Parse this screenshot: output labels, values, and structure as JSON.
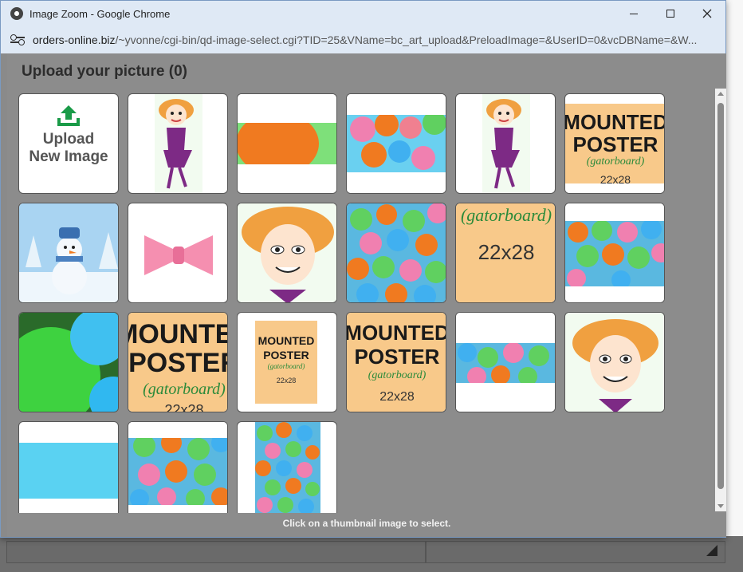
{
  "window": {
    "title": "Image Zoom - Google Chrome",
    "url_host": "orders-online.biz",
    "url_path": "/~yvonne/cgi-bin/qd-image-select.cgi?TID=25&VName=bc_art_upload&PreloadImage=&UserID=0&vcDBName=&W..."
  },
  "page": {
    "heading": "Upload your picture (0)",
    "upload_line1": "Upload",
    "upload_line2": "New Image",
    "hint": "Click on a thumbnail image to select."
  },
  "poster_text": {
    "line1": "MOUNTED",
    "line2": "POSTER",
    "line3": "(gatorboard)",
    "size": "22x28"
  },
  "colors": {
    "accent_green": "#1a9b48",
    "poster_bg": "#f8c98a",
    "lady_hair": "#f0a040",
    "lady_dress": "#7d2a85"
  }
}
